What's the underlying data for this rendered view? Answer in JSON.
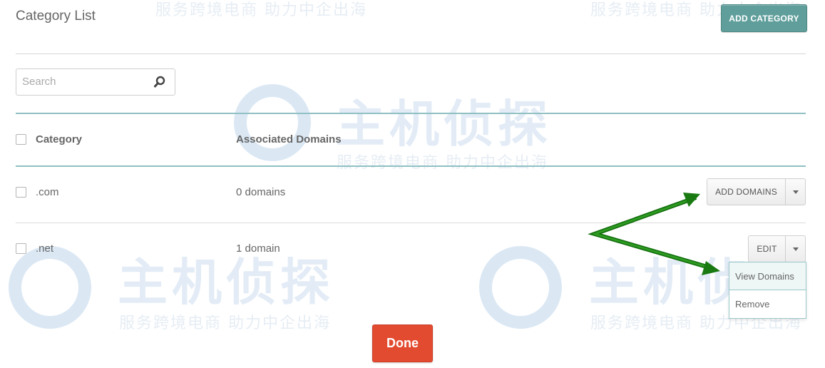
{
  "header": {
    "title": "Category List",
    "add_category_label": "ADD CATEGORY"
  },
  "search": {
    "placeholder": "Search",
    "value": ""
  },
  "table": {
    "columns": [
      "Category",
      "Associated Domains"
    ],
    "rows": [
      {
        "category": ".com",
        "domains": "0 domains",
        "action_label": "ADD DOMAINS"
      },
      {
        "category": ".net",
        "domains": "1 domain",
        "action_label": "EDIT"
      }
    ]
  },
  "dropdown": {
    "items": [
      "View Domains",
      "Remove"
    ]
  },
  "footer": {
    "done_label": "Done"
  },
  "watermark": {
    "brand": "主机侦探",
    "slogan": "服务跨境电商 助力中企出海"
  },
  "colors": {
    "accent_teal": "#5f9e9b",
    "divider_teal": "#8fc0c3",
    "done_red": "#e34b30",
    "arrow_green": "#1a7a12"
  },
  "icons": {
    "search": "magnifier-icon",
    "caret": "caret-down-icon"
  }
}
